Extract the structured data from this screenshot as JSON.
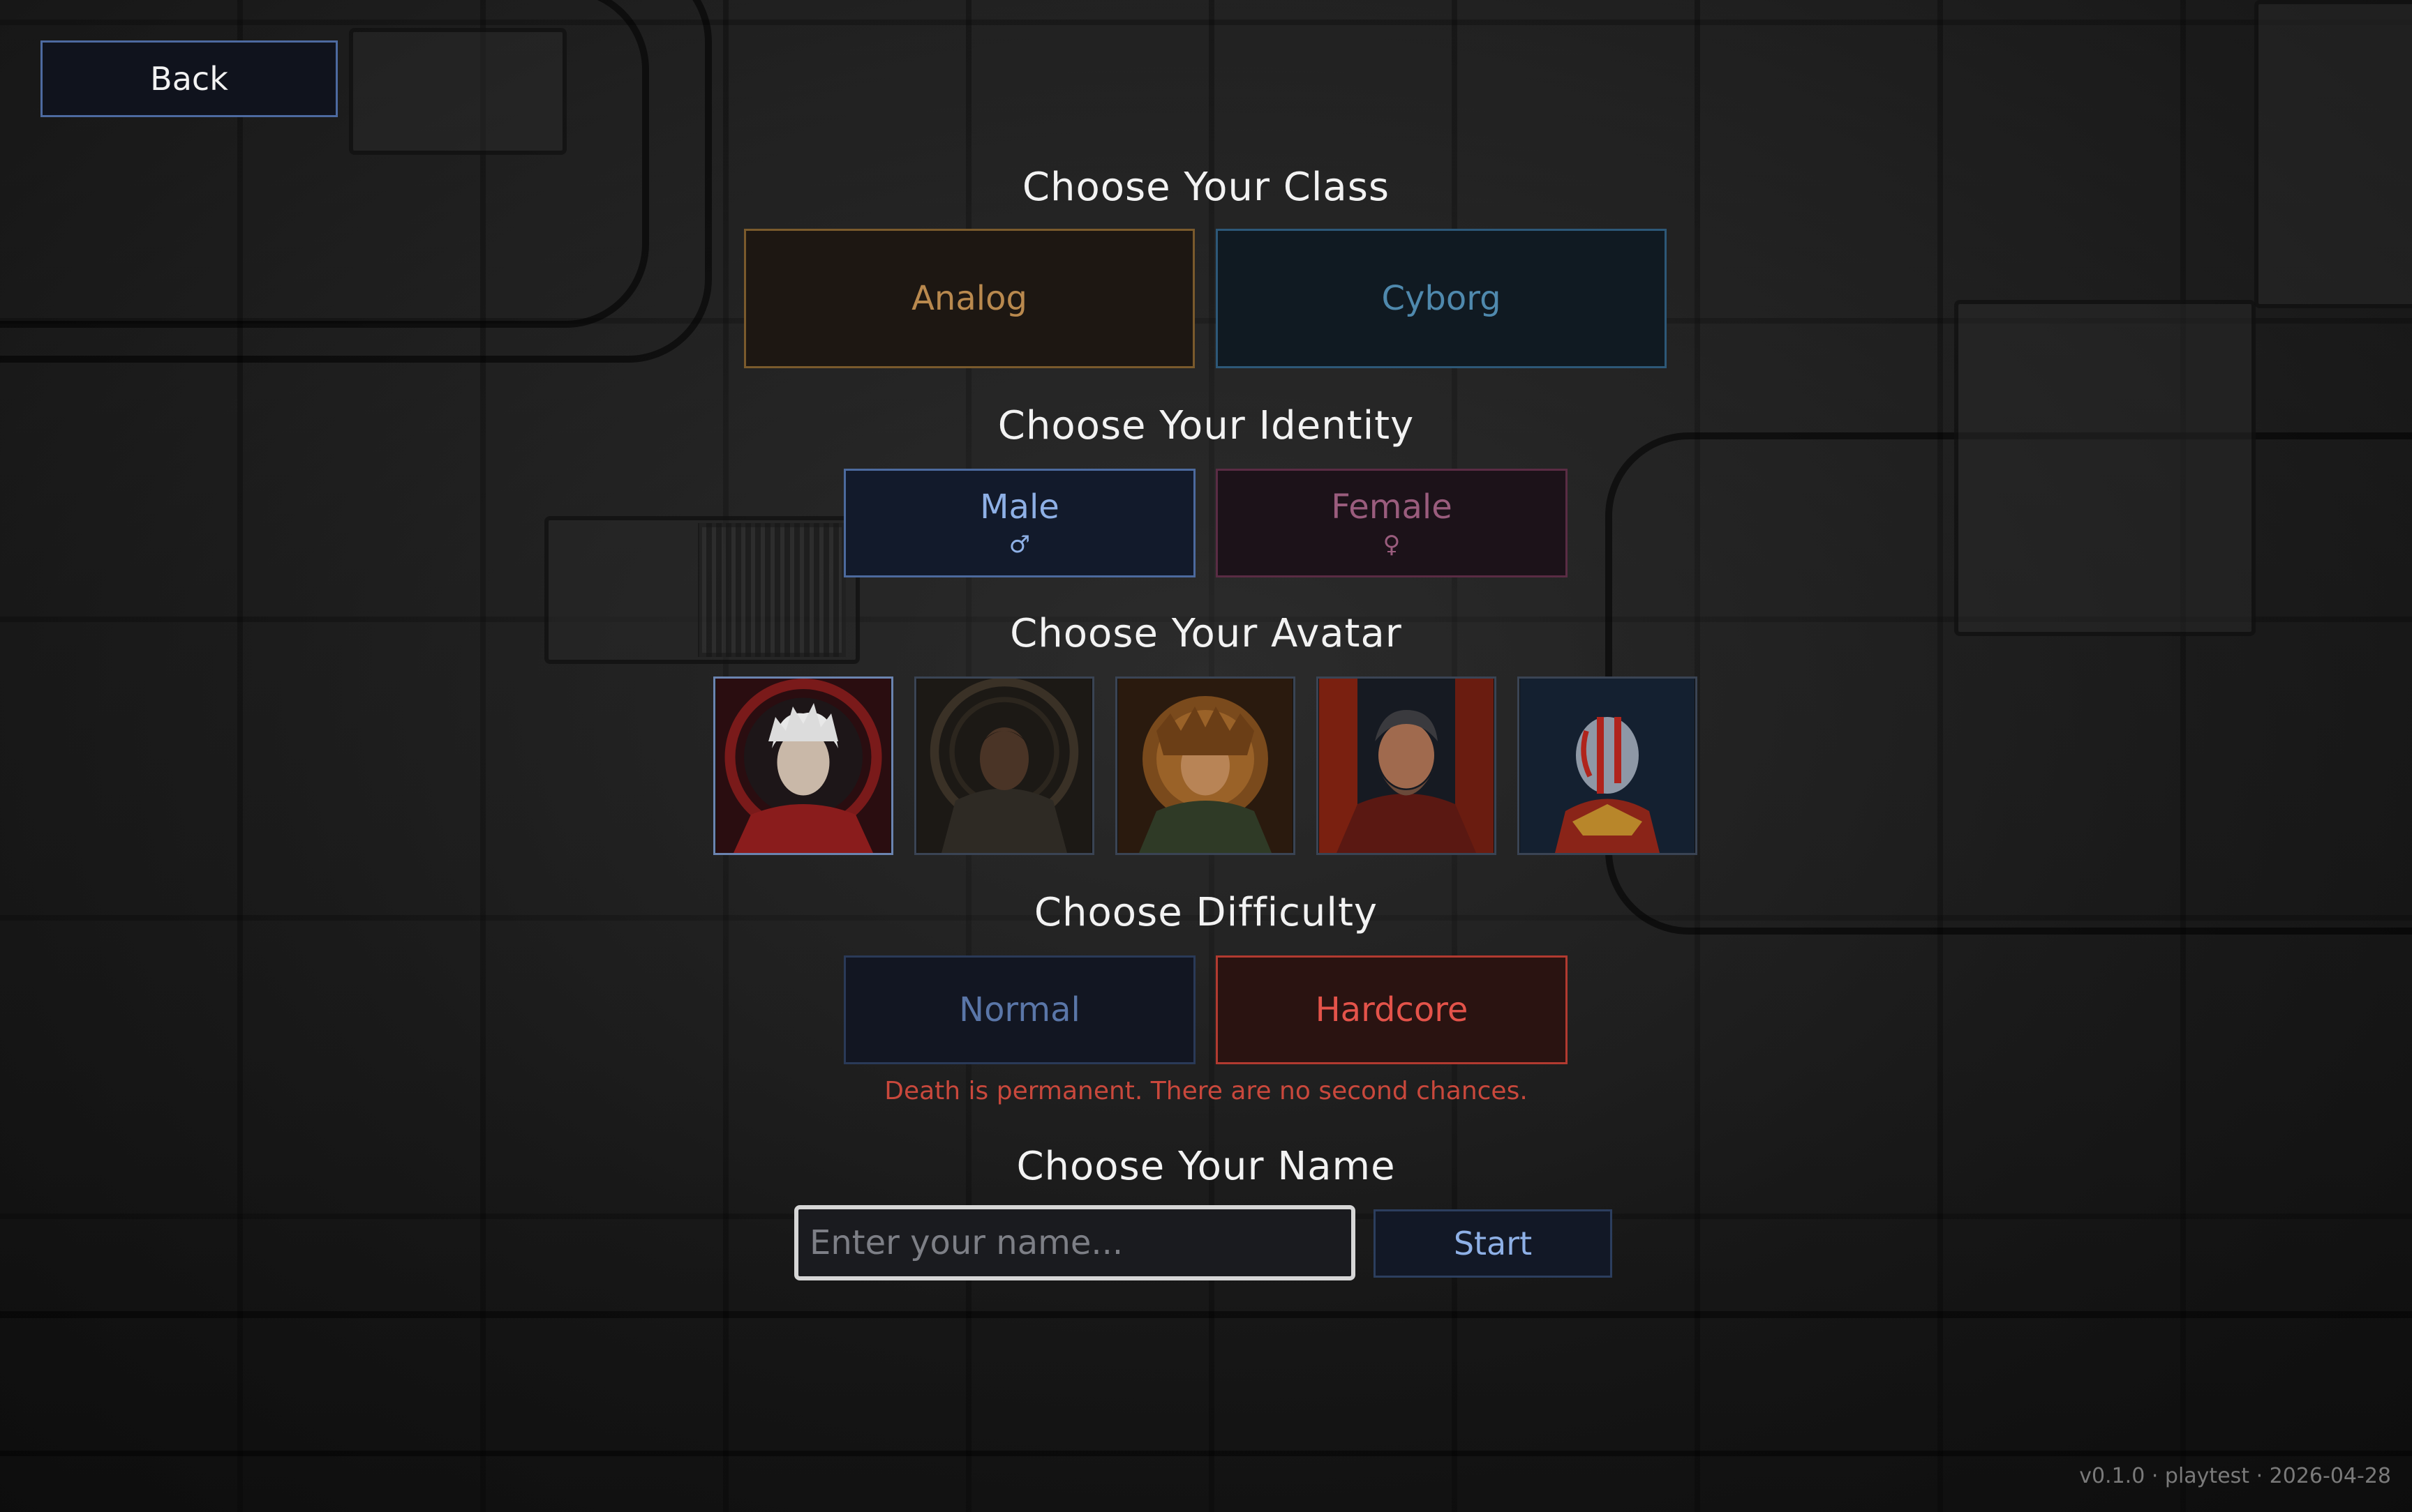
{
  "back": {
    "label": "Back"
  },
  "class_section": {
    "title": "Choose Your Class",
    "options": [
      {
        "label": "Analog"
      },
      {
        "label": "Cyborg"
      }
    ]
  },
  "identity_section": {
    "title": "Choose Your Identity",
    "options": [
      {
        "label": "Male",
        "symbol": "♂"
      },
      {
        "label": "Female",
        "symbol": "♀"
      }
    ]
  },
  "avatar_section": {
    "title": "Choose Your Avatar",
    "avatars": [
      {
        "icon": "white-haired-man-portrait",
        "selected": true
      },
      {
        "icon": "hooded-dark-man-portrait",
        "selected": false
      },
      {
        "icon": "lion-maned-warrior-portrait",
        "selected": false
      },
      {
        "icon": "bearded-gray-man-portrait",
        "selected": false
      },
      {
        "icon": "bald-red-painted-warrior-portrait",
        "selected": false
      }
    ]
  },
  "difficulty_section": {
    "title": "Choose Difficulty",
    "options": [
      {
        "label": "Normal",
        "selected": false
      },
      {
        "label": "Hardcore",
        "selected": true
      }
    ],
    "warning": "Death is permanent. There are no second chances."
  },
  "name_section": {
    "title": "Choose Your Name",
    "input_value": "",
    "input_placeholder": "Enter your name...",
    "start_label": "Start"
  },
  "version_text": "v0.1.0 · playtest · 2026-04-28",
  "colors": {
    "analog": "#b9894e",
    "cyborg": "#4f89ad",
    "male": "#8eb0e6",
    "female": "#9a5c7d",
    "hardcore": "#e4534a",
    "warning": "#c9483c"
  }
}
